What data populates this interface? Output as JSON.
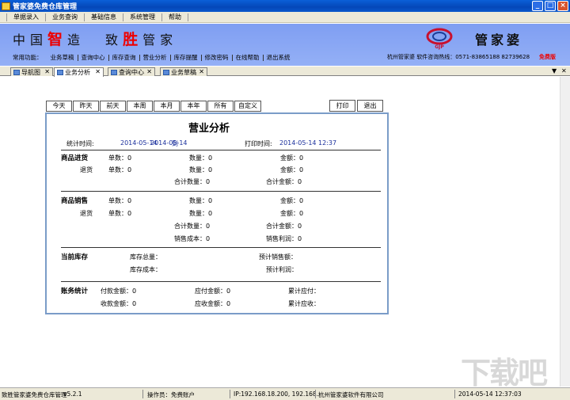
{
  "window": {
    "title": "管家婆免费仓库管理"
  },
  "menu": [
    "单据录入",
    "业务查询",
    "基础信息",
    "系统管理",
    "帮助"
  ],
  "banner": {
    "slogan_1": "中国",
    "slogan_red_1": "智",
    "slogan_2": "造",
    "slogan_3": "致",
    "slogan_red_2": "胜",
    "slogan_4": "管家",
    "brand": "管家婆",
    "logo_text": "GJP",
    "common_label": "常用功能：",
    "links": [
      "业务草稿",
      "查询中心",
      "库存查询",
      "营业分析",
      "库存提醒",
      "修改密码",
      "在线帮助",
      "退出系统"
    ],
    "hotline": "杭州管家婆  软件咨询热线：0571-83865188  82739628",
    "free_badge": "免费版"
  },
  "tabs": [
    "导航图",
    "业务分析",
    "查询中心",
    "业务草稿"
  ],
  "filters": [
    "今天",
    "昨天",
    "前天",
    "本周",
    "本月",
    "本年",
    "所有",
    "自定义"
  ],
  "tools": {
    "print": "打印",
    "exit": "退出"
  },
  "report": {
    "title": "营业分析",
    "period_label": "统计时间:",
    "period_from": "2014-05-14",
    "period_to_label": "到",
    "period_to": "2014-05-14",
    "print_label": "打印时间:",
    "print_time": "2014-05-14 12:37",
    "purchase": {
      "title": "商品进货",
      "count": "单数：0",
      "qty": "数量：0",
      "amount": "金额：0",
      "return_label": "退货",
      "return_count": "单数：0",
      "return_qty": "数量：0",
      "return_amount": "金额：0",
      "total_qty": "合计数量：0",
      "total_amount": "合计金额：0"
    },
    "sales": {
      "title": "商品销售",
      "count": "单数：0",
      "qty": "数量：0",
      "amount": "金额：0",
      "return_label": "退货",
      "return_count": "单数：0",
      "return_qty": "数量：0",
      "return_amount": "金额：0",
      "total_qty": "合计数量：0",
      "total_amount": "合计金额：0",
      "cost": "销售成本：0",
      "profit": "销售利润：0"
    },
    "stock": {
      "title": "当前库存",
      "total_qty": "库存总量：",
      "cost": "库存成本：",
      "est_sales": "预计销售额：",
      "est_profit": "预计利润："
    },
    "finance": {
      "title": "账务统计",
      "paid": "付款金额：0",
      "payable": "应付金额：0",
      "acc_payable": "累计应付：",
      "received": "收款金额：0",
      "receivable": "应收金额：0",
      "acc_receivable": "累计应收："
    }
  },
  "status": {
    "app": "致胜管家婆免费仓库管理",
    "version": "v5.2.1",
    "operator": "操作员：免费账户",
    "ip": "IP:192.168.18.200, 192.168.",
    "company": "杭州管家婆软件有限公司",
    "time": "2014-05-14 12:37:03"
  },
  "watermark": "下载吧"
}
